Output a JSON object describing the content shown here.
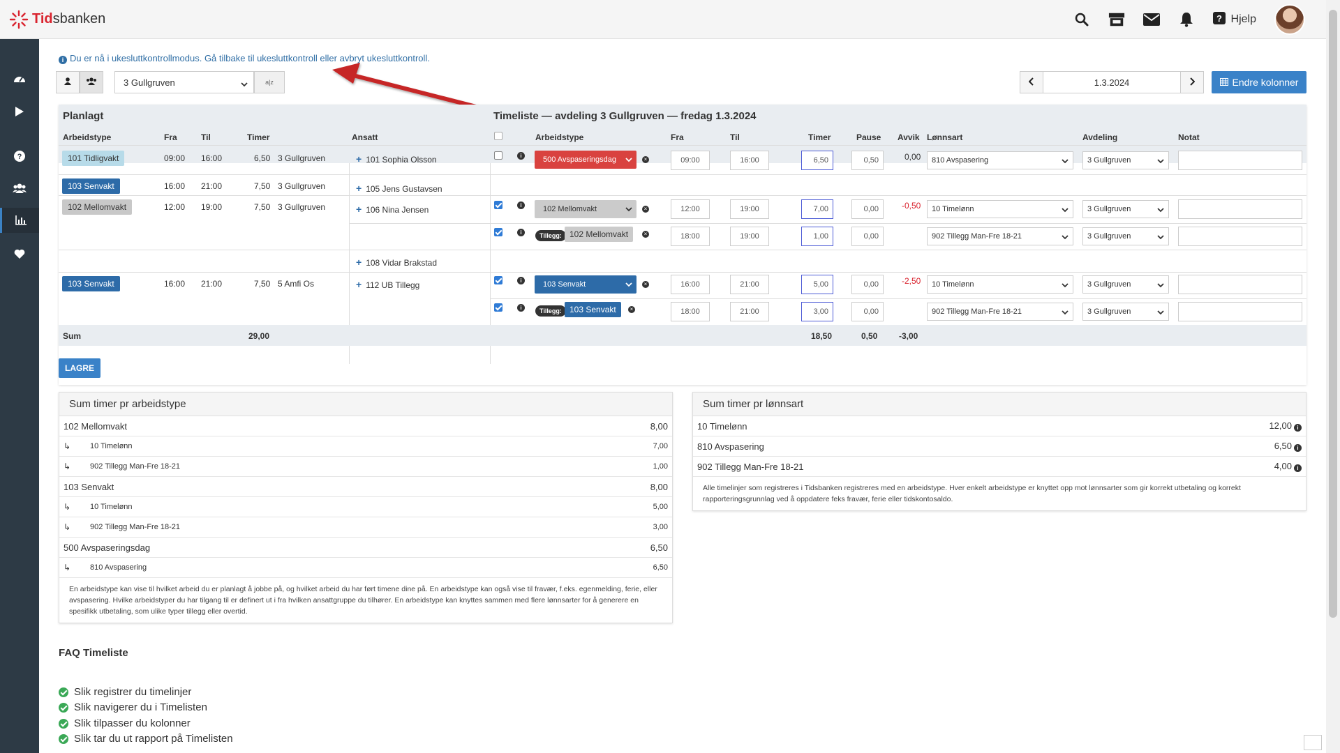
{
  "app": {
    "brand_red": "Tid",
    "brand_rest": "sbanken",
    "help_label": "Hjelp"
  },
  "notice": {
    "prefix": "Du er nå i ukesluttkontrollmodus. ",
    "link1": "Gå tilbake til ukesluttkontroll",
    "mid": " eller ",
    "link2": "avbryt ukesluttkontroll",
    "suffix": "."
  },
  "toolbar": {
    "department": "3 Gullgruven",
    "sort_label": "a|z",
    "date": "1.3.2024",
    "endre_label": "Endre kolonner"
  },
  "planned": {
    "title": "Planlagt",
    "headers": {
      "arbeidstype": "Arbeidstype",
      "fra": "Fra",
      "til": "Til",
      "timer": "Timer",
      "ansatt": "Ansatt"
    },
    "rows": [
      {
        "type": "101 Tidligvakt",
        "fra": "09:00",
        "til": "16:00",
        "timer": "6,50",
        "dept": "3 Gullgruven",
        "ansatt": "101 Sophia Olsson"
      },
      {
        "type": "103 Senvakt",
        "fra": "16:00",
        "til": "21:00",
        "timer": "7,50",
        "dept": "3 Gullgruven",
        "ansatt": "105 Jens Gustavsen"
      },
      {
        "type": "102 Mellomvakt",
        "fra": "12:00",
        "til": "19:00",
        "timer": "7,50",
        "dept": "3 Gullgruven",
        "ansatt": "106 Nina Jensen"
      },
      {
        "ansatt": "108 Vidar Brakstad"
      },
      {
        "type": "103 Senvakt",
        "fra": "16:00",
        "til": "21:00",
        "timer": "7,50",
        "dept": "5 Amfi Os",
        "ansatt": "112 UB Tillegg"
      }
    ],
    "sum_label": "Sum",
    "sum_timer": "29,00"
  },
  "timeliste": {
    "title": "Timeliste — avdeling 3 Gullgruven — fredag 1.3.2024",
    "headers": {
      "arbeidstype": "Arbeidstype",
      "fra": "Fra",
      "til": "Til",
      "timer": "Timer",
      "pause": "Pause",
      "avvik": "Avvik",
      "lonnsart": "Lønnsart",
      "avdeling": "Avdeling",
      "notat": "Notat"
    },
    "rows": [
      {
        "type": "500 Avspaseringsdag",
        "fra": "09:00",
        "til": "16:00",
        "timer": "6,50",
        "pause": "0,50",
        "avvik": "0,00",
        "lonnsart": "810 Avspasering",
        "avdeling": "3 Gullgruven"
      },
      {
        "type": "102 Mellomvakt",
        "fra": "12:00",
        "til": "19:00",
        "timer": "7,00",
        "pause": "0,00",
        "avvik": "-0,50",
        "lonnsart": "10 Timelønn",
        "avdeling": "3 Gullgruven"
      },
      {
        "tillegg": "Tillegg:",
        "type": "102 Mellomvakt",
        "fra": "18:00",
        "til": "19:00",
        "timer": "1,00",
        "pause": "0,00",
        "lonnsart": "902 Tillegg Man-Fre 18-21",
        "avdeling": "3 Gullgruven"
      },
      {
        "type": "103 Senvakt",
        "fra": "16:00",
        "til": "21:00",
        "timer": "5,00",
        "pause": "0,00",
        "avvik": "-2,50",
        "lonnsart": "10 Timelønn",
        "avdeling": "3 Gullgruven"
      },
      {
        "tillegg": "Tillegg:",
        "type": "103 Senvakt",
        "fra": "18:00",
        "til": "21:00",
        "timer": "3,00",
        "pause": "0,00",
        "lonnsart": "902 Tillegg Man-Fre 18-21",
        "avdeling": "3 Gullgruven"
      }
    ],
    "sum_timer": "18,50",
    "sum_pause": "0,50",
    "sum_avvik": "-3,00"
  },
  "save_label": "LAGRE",
  "sum_arbeidstype": {
    "title": "Sum timer pr arbeidstype",
    "rows": [
      {
        "label": "102 Mellomvakt",
        "value": "8,00"
      },
      {
        "label": "10 Timelønn",
        "value": "7,00"
      },
      {
        "label": "902 Tillegg Man-Fre 18-21",
        "value": "1,00"
      },
      {
        "label": "103 Senvakt",
        "value": "8,00"
      },
      {
        "label": "10 Timelønn",
        "value": "5,00"
      },
      {
        "label": "902 Tillegg Man-Fre 18-21",
        "value": "3,00"
      },
      {
        "label": "500 Avspaseringsdag",
        "value": "6,50"
      },
      {
        "label": "810 Avspasering",
        "value": "6,50"
      }
    ],
    "note": "En arbeidstype kan vise til hvilket arbeid du er planlagt å jobbe på, og hvilket arbeid du har ført timene dine på. En arbeidstype kan også vise til fravær, f.eks. egenmelding, ferie, eller avspasering. Hvilke arbeidstyper du har tilgang til er definert ut i fra hvilken ansattgruppe du tilhører. En arbeidstype kan knyttes sammen med flere lønnsarter for å generere en spesifikk utbetaling, som ulike typer tillegg eller overtid."
  },
  "sum_lonnsart": {
    "title": "Sum timer pr lønnsart",
    "rows": [
      {
        "label": "10 Timelønn",
        "value": "12,00"
      },
      {
        "label": "810 Avspasering",
        "value": "6,50"
      },
      {
        "label": "902 Tillegg Man-Fre 18-21",
        "value": "4,00"
      }
    ],
    "note": "Alle timelinjer som registreres i Tidsbanken registreres med en arbeidstype. Hver enkelt arbeidstype er knyttet opp mot lønnsarter som gir korrekt utbetaling og korrekt rapporteringsgrunnlag ved å oppdatere feks fravær, ferie eller tidskontosaldo."
  },
  "faq": {
    "title": "FAQ Timeliste",
    "items": [
      "Slik registrer du timelinjer",
      "Slik navigerer du i Timelisten",
      "Slik tilpasser du kolonner",
      "Slik tar du ut rapport på Timelisten"
    ]
  },
  "icons": [
    "search-icon",
    "store-icon",
    "mail-icon",
    "bell-icon",
    "question-icon",
    "dashboard-icon",
    "play-icon",
    "help-circle-icon",
    "users-icon",
    "chart-icon",
    "heart-icon",
    "user-icon",
    "group-icon",
    "chevron-left-icon",
    "chevron-right-icon",
    "table-icon",
    "info-icon",
    "close-circle-icon",
    "check-circle-icon",
    "arrow-return-icon"
  ],
  "colors": {
    "primary": "#3a82c8",
    "sidebar": "#2d3a45",
    "brand_red": "#d9232e",
    "red_type": "#d9423f",
    "blue_type": "#2d6ba8",
    "arrow": "#c62828"
  }
}
